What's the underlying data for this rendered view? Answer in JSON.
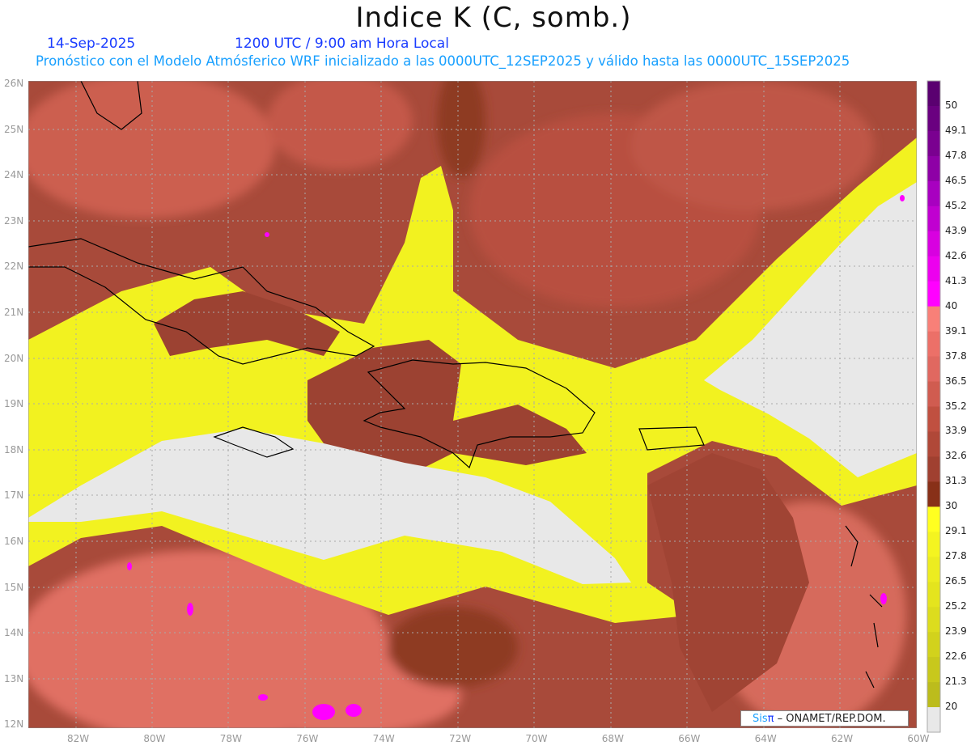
{
  "title": "Indice K (C, somb.)",
  "date": "14-Sep-2025",
  "time": "1200 UTC / 9:00 am Hora Local",
  "model_line": "Pronóstico con el Modelo Atmósferico WRF inicializado a las 0000UTC_12SEP2025 y válido hasta las  0000UTC_15SEP2025",
  "credit": {
    "brand_a": "Sis",
    "brand_b": "π",
    "text": "– ONAMET/REP.DOM."
  },
  "lat_labels": [
    "26N",
    "25N",
    "24N",
    "23N",
    "22N",
    "21N",
    "20N",
    "19N",
    "18N",
    "17N",
    "16N",
    "15N",
    "14N",
    "13N",
    "12N"
  ],
  "lon_labels": [
    "82W",
    "80W",
    "78W",
    "76W",
    "74W",
    "72W",
    "70W",
    "68W",
    "66W",
    "64W",
    "62W",
    "60W"
  ],
  "colorbar": {
    "labels": [
      "50",
      "49.1",
      "47.8",
      "46.5",
      "45.2",
      "43.9",
      "42.6",
      "41.3",
      "40",
      "39.1",
      "37.8",
      "36.5",
      "35.2",
      "33.9",
      "32.6",
      "31.3",
      "30",
      "29.1",
      "27.8",
      "26.5",
      "25.2",
      "23.9",
      "22.6",
      "21.3",
      "20"
    ],
    "colors": [
      "#5a0070",
      "#6a0080",
      "#7a0090",
      "#8e00a6",
      "#a800c0",
      "#c000d0",
      "#d800e0",
      "#ec00ee",
      "#ff00ff",
      "#f88078",
      "#ec7068",
      "#e06860",
      "#d05c50",
      "#c05040",
      "#b04838",
      "#a04030",
      "#883018",
      "#ffff20",
      "#f4f420",
      "#ecec20",
      "#e4e41e",
      "#dcdc1e",
      "#d2d21c",
      "#c8c81c",
      "#bcbc1c",
      "#e8e8e8"
    ]
  }
}
